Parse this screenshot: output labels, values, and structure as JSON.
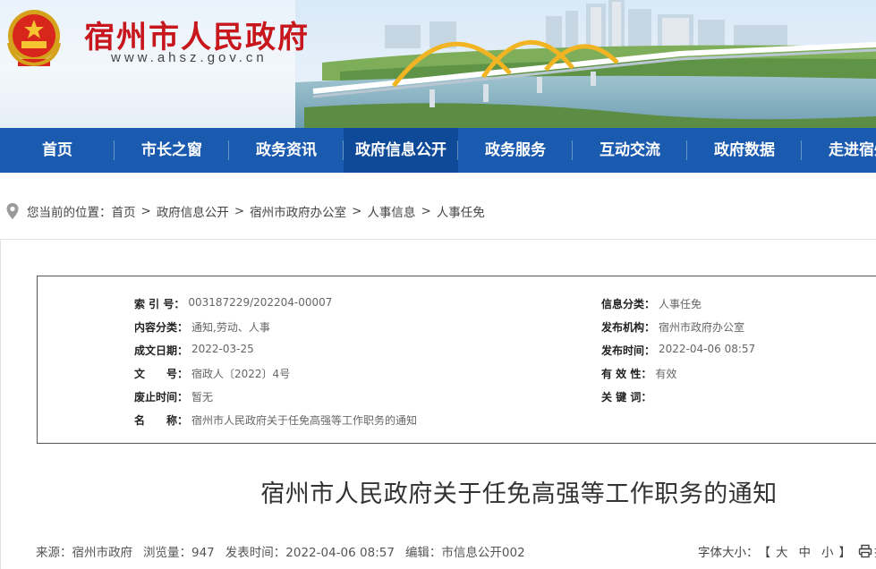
{
  "header": {
    "title": "宿州市人民政府",
    "url": "www.ahsz.gov.cn"
  },
  "nav": {
    "items": [
      {
        "label": "首页"
      },
      {
        "label": "市长之窗"
      },
      {
        "label": "政务资讯"
      },
      {
        "label": "政府信息公开"
      },
      {
        "label": "政务服务"
      },
      {
        "label": "互动交流"
      },
      {
        "label": "政府数据"
      },
      {
        "label": "走进宿州"
      }
    ],
    "active_index": 3
  },
  "breadcrumb": {
    "prefix": "您当前的位置：",
    "items": [
      "首页",
      "政府信息公开",
      "宿州市政府办公室",
      "人事信息",
      "人事任免"
    ],
    "separator": ">"
  },
  "meta": {
    "index_label": "索 引 号：",
    "index_value": "003187229/202204-00007",
    "content_type_label": "内容分类：",
    "content_type_value": "通知,劳动、人事",
    "created_label": "成文日期：",
    "created_value": "2022-03-25",
    "doc_no_label": "文　　号：",
    "doc_no_value": "宿政人〔2022〕4号",
    "expired_label": "废止时间：",
    "expired_value": "暂无",
    "name_label": "名　　称：",
    "name_value": "宿州市人民政府关于任免高强等工作职务的通知",
    "info_type_label": "信息分类：",
    "info_type_value": "人事任免",
    "publisher_label": "发布机构：",
    "publisher_value": "宿州市政府办公室",
    "publish_time_label": "发布时间：",
    "publish_time_value": "2022-04-06 08:57",
    "valid_label": "有 效 性：",
    "valid_value": "有效",
    "keywords_label": "关 键 词：",
    "keywords_value": ""
  },
  "article": {
    "title": "宿州市人民政府关于任免高强等工作职务的通知",
    "source": "来源：宿州市政府",
    "views": "浏览量：947",
    "publish_time": "发表时间：2022-04-06 08:57",
    "editor": "编辑：市信息公开002",
    "font_size_label": "字体大小：",
    "font_bracket_open": "【",
    "font_large": "大",
    "font_medium": "中",
    "font_small": "小",
    "font_bracket_close": "】",
    "print_label": "打"
  },
  "colors": {
    "brand_red": "#c8161d",
    "nav_blue": "#1a5aaf",
    "nav_active": "#0e4a98"
  }
}
